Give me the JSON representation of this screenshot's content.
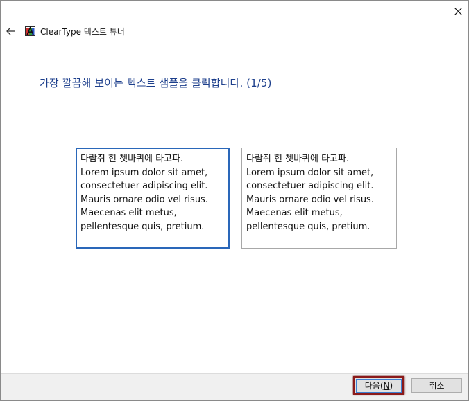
{
  "window": {
    "title": "ClearType 텍스트 튜너",
    "close_glyph": "✕",
    "back_icon": "arrow-left-icon"
  },
  "page": {
    "instruction": "가장 깔끔해 보이는 텍스트 샘플을 클릭합니다. (1/5)"
  },
  "samples": [
    {
      "selected": true,
      "lines": [
        "다람쥐 헌 쳇바퀴에 타고파.",
        "Lorem ipsum dolor sit amet,",
        "consectetuer adipiscing elit.",
        "Mauris ornare odio vel risus.",
        "Maecenas elit metus,",
        "pellentesque quis, pretium."
      ]
    },
    {
      "selected": false,
      "lines": [
        "다람쥐 헌 쳇바퀴에 타고파.",
        "Lorem ipsum dolor sit amet,",
        "consectetuer adipiscing elit.",
        "Mauris ornare odio vel risus.",
        "Maecenas elit metus,",
        "pellentesque quis, pretium."
      ]
    }
  ],
  "footer": {
    "next_label": "다음",
    "next_mnemonic": "N",
    "cancel_label": "취소"
  },
  "colors": {
    "instruction": "#1d3f8c",
    "selected_border": "#2a67b9",
    "highlight_frame": "#8b1a1a"
  }
}
